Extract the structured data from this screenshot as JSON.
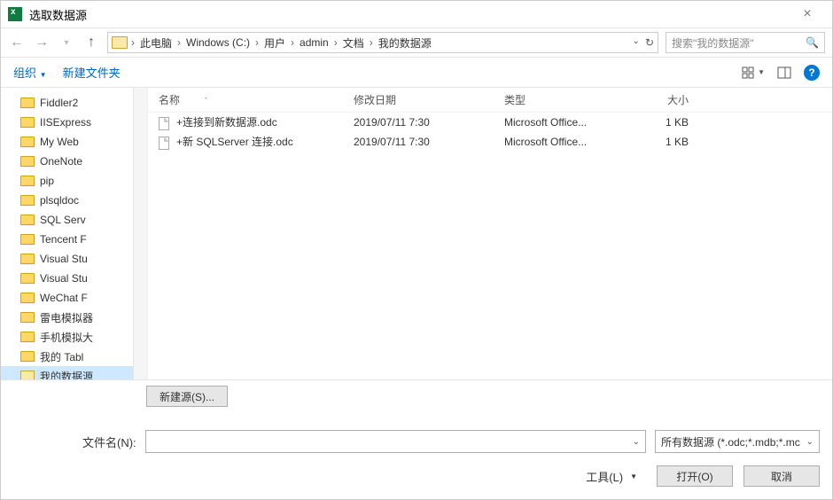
{
  "titlebar": {
    "title": "选取数据源"
  },
  "breadcrumbs": [
    "此电脑",
    "Windows (C:)",
    "用户",
    "admin",
    "文档",
    "我的数据源"
  ],
  "search": {
    "placeholder": "搜索\"我的数据源\""
  },
  "cmdbar": {
    "organize": "组织",
    "new_folder": "新建文件夹"
  },
  "tree": {
    "items": [
      {
        "label": "Fiddler2",
        "type": "folder"
      },
      {
        "label": "IISExpress",
        "type": "folder"
      },
      {
        "label": "My Web",
        "type": "folder"
      },
      {
        "label": "OneNote",
        "type": "folder"
      },
      {
        "label": "pip",
        "type": "folder"
      },
      {
        "label": "plsqldoc",
        "type": "folder"
      },
      {
        "label": "SQL Serv",
        "type": "folder"
      },
      {
        "label": "Tencent F",
        "type": "folder"
      },
      {
        "label": "Visual Stu",
        "type": "folder"
      },
      {
        "label": "Visual Stu",
        "type": "folder"
      },
      {
        "label": "WeChat F",
        "type": "folder"
      },
      {
        "label": "雷电模拟器",
        "type": "folder"
      },
      {
        "label": "手机模拟大",
        "type": "folder"
      },
      {
        "label": "我的 Tabl",
        "type": "folder"
      },
      {
        "label": "我的数据源",
        "type": "ds",
        "sel": true
      }
    ]
  },
  "listhead": {
    "name": "名称",
    "date": "修改日期",
    "type": "类型",
    "size": "大小"
  },
  "files": [
    {
      "name": "+连接到新数据源.odc",
      "date": "2019/07/11 7:30",
      "type": "Microsoft Office...",
      "size": "1 KB"
    },
    {
      "name": "+新 SQLServer 连接.odc",
      "date": "2019/07/11 7:30",
      "type": "Microsoft Office...",
      "size": "1 KB"
    }
  ],
  "bottom": {
    "new_source": "新建源(S)...",
    "filename_label": "文件名(N):",
    "filename_value": "",
    "filetype": "所有数据源 (*.odc;*.mdb;*.mc",
    "tools": "工具(L)",
    "open": "打开(O)",
    "cancel": "取消"
  }
}
